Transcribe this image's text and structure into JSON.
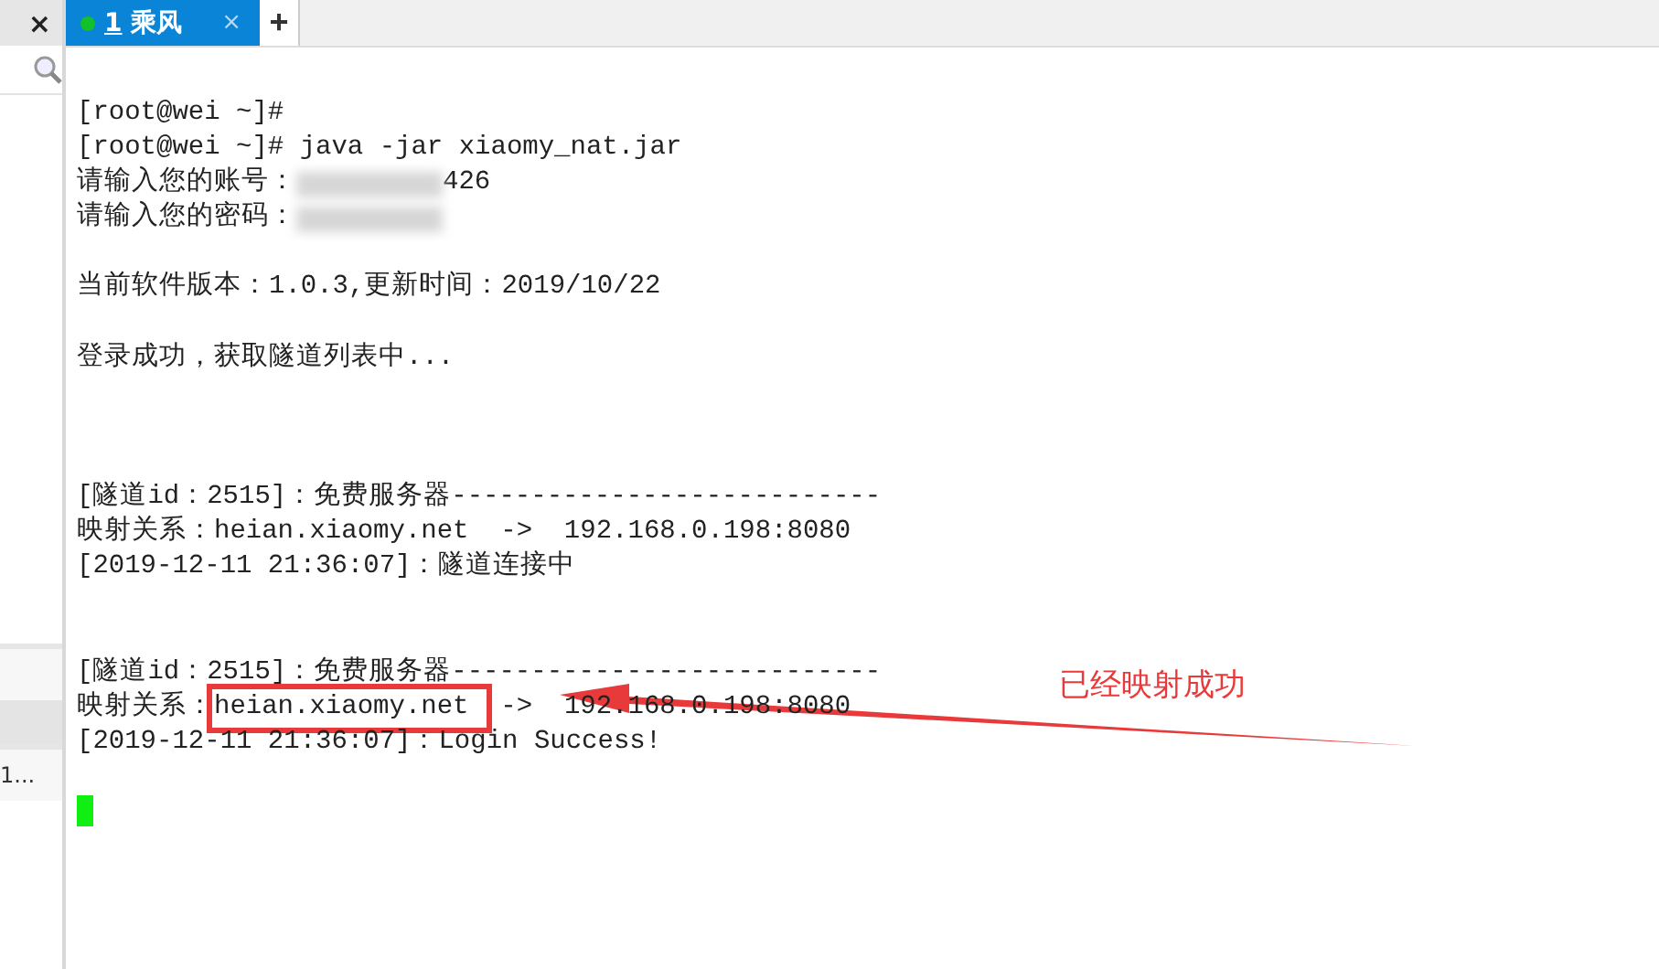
{
  "sidebar": {
    "close": "×",
    "rows": [
      {
        "text": "",
        "selected": false
      },
      {
        "text": "",
        "selected": true
      },
      {
        "text": "1...",
        "selected": false
      }
    ]
  },
  "tabs": [
    {
      "number": "1",
      "label": "乘风",
      "close": "×",
      "selected": true
    }
  ],
  "new_tab": "+",
  "terminal": {
    "lines": [
      {
        "kind": "text",
        "text": "[root@wei ~]#"
      },
      {
        "kind": "text",
        "text": "[root@wei ~]# java -jar xiaomy_nat.jar"
      },
      {
        "kind": "redacted",
        "prefix": "请输入您的账号：",
        "suffix": "426"
      },
      {
        "kind": "redacted",
        "prefix": "请输入您的密码："
      },
      {
        "kind": "blank"
      },
      {
        "kind": "text",
        "text": "当前软件版本：1.0.3,更新时间：2019/10/22"
      },
      {
        "kind": "blank"
      },
      {
        "kind": "text",
        "text": "登录成功，获取隧道列表中..."
      },
      {
        "kind": "blank"
      },
      {
        "kind": "blank"
      },
      {
        "kind": "blank"
      },
      {
        "kind": "text",
        "text": "[隧道id：2515]：免费服务器---------------------------"
      },
      {
        "kind": "text",
        "text": "映射关系：heian.xiaomy.net  ->  192.168.0.198:8080"
      },
      {
        "kind": "text",
        "text": "[2019-12-11 21:36:07]：隧道连接中"
      },
      {
        "kind": "blank"
      },
      {
        "kind": "blank"
      },
      {
        "kind": "text",
        "text": "[隧道id：2515]：免费服务器---------------------------"
      },
      {
        "kind": "annotated",
        "segments": [
          {
            "text": "映射关系：",
            "highlighted": false
          },
          {
            "text": "heian.xiaomy.net ",
            "highlighted": true
          },
          {
            "text": " ->  192.168.0.198:8080",
            "highlighted": false
          }
        ]
      },
      {
        "kind": "text",
        "text": "[2019-12-11 21:36:07]：Login Success!"
      },
      {
        "kind": "blank"
      },
      {
        "kind": "cursor"
      }
    ]
  },
  "annotation": {
    "label": "已经映射成功"
  }
}
